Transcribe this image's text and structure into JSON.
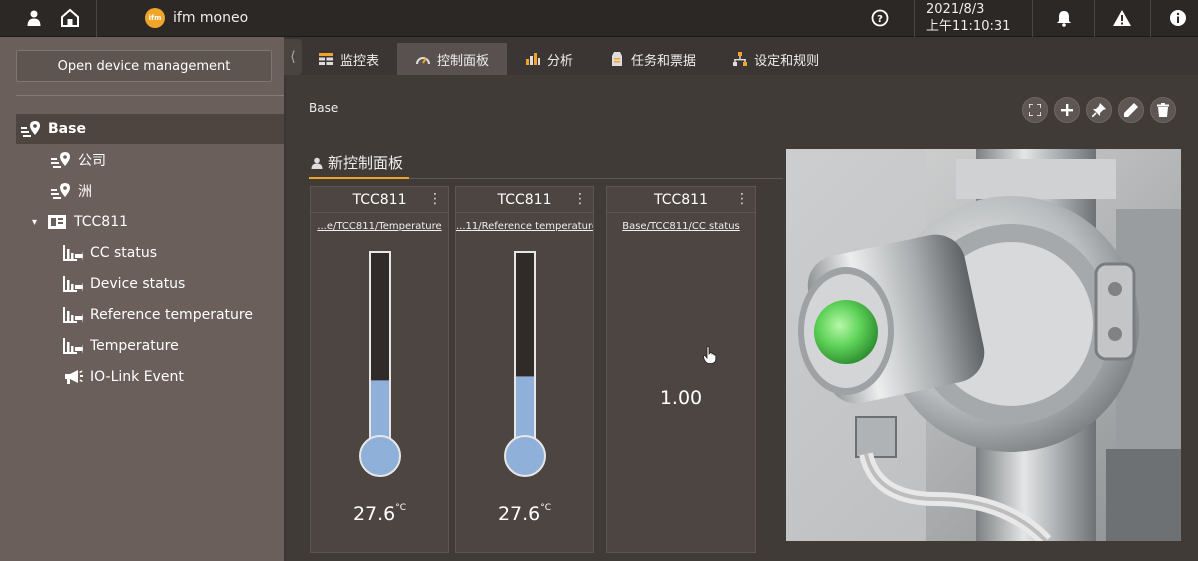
{
  "header": {
    "brand_logo_text": "ifm",
    "app_name": "ifm moneo",
    "date": "2021/8/3",
    "time": "上午11:10:31",
    "icons": [
      "user-icon",
      "home-icon",
      "help-icon",
      "bell-icon",
      "warning-icon",
      "info-icon"
    ]
  },
  "sidebar": {
    "open_device_label": "Open device management",
    "collapse_glyph": "⟨",
    "tree": [
      {
        "label": "Base",
        "icon": "location-tree-icon",
        "selected": true
      },
      {
        "label": "公司",
        "icon": "location-tree-icon"
      },
      {
        "label": "洲",
        "icon": "location-tree-icon"
      },
      {
        "label": "TCC811",
        "icon": "device-icon",
        "expander": "▾"
      },
      {
        "label": "CC status",
        "icon": "chart-icon"
      },
      {
        "label": "Device status",
        "icon": "chart-icon"
      },
      {
        "label": "Reference temperature",
        "icon": "chart-icon"
      },
      {
        "label": "Temperature",
        "icon": "chart-icon"
      },
      {
        "label": "IO-Link Event",
        "icon": "megaphone-icon"
      }
    ]
  },
  "tabs": [
    {
      "label": "监控表",
      "icon": "table-icon"
    },
    {
      "label": "控制面板",
      "icon": "gauge-icon",
      "active": true
    },
    {
      "label": "分析",
      "icon": "analysis-icon"
    },
    {
      "label": "任务和票据",
      "icon": "ticket-icon"
    },
    {
      "label": "设定和规则",
      "icon": "rules-icon"
    }
  ],
  "main": {
    "breadcrumb": "Base",
    "dashboard_title": "新控制面板",
    "toolbar": [
      "fullscreen-icon",
      "plus-icon",
      "pin-icon",
      "pencil-icon",
      "trash-icon"
    ],
    "widgets": [
      {
        "title": "TCC811",
        "menu": "⋮",
        "link": "...e/TCC811/Temperature",
        "value": "27.6",
        "unit": "°C",
        "fill_fraction": 0.36
      },
      {
        "title": "TCC811",
        "menu": "⋮",
        "link": "...11/Reference temperature",
        "value": "27.6",
        "unit": "°C",
        "fill_fraction": 0.38
      },
      {
        "title": "TCC811",
        "menu": "⋮",
        "link": "Base/TCC811/CC status",
        "value": "1.00"
      }
    ]
  },
  "colors": {
    "accent": "#f0a52a",
    "thermo_fill": "#8fb0d9",
    "sensor_led": "#5fd35a"
  }
}
